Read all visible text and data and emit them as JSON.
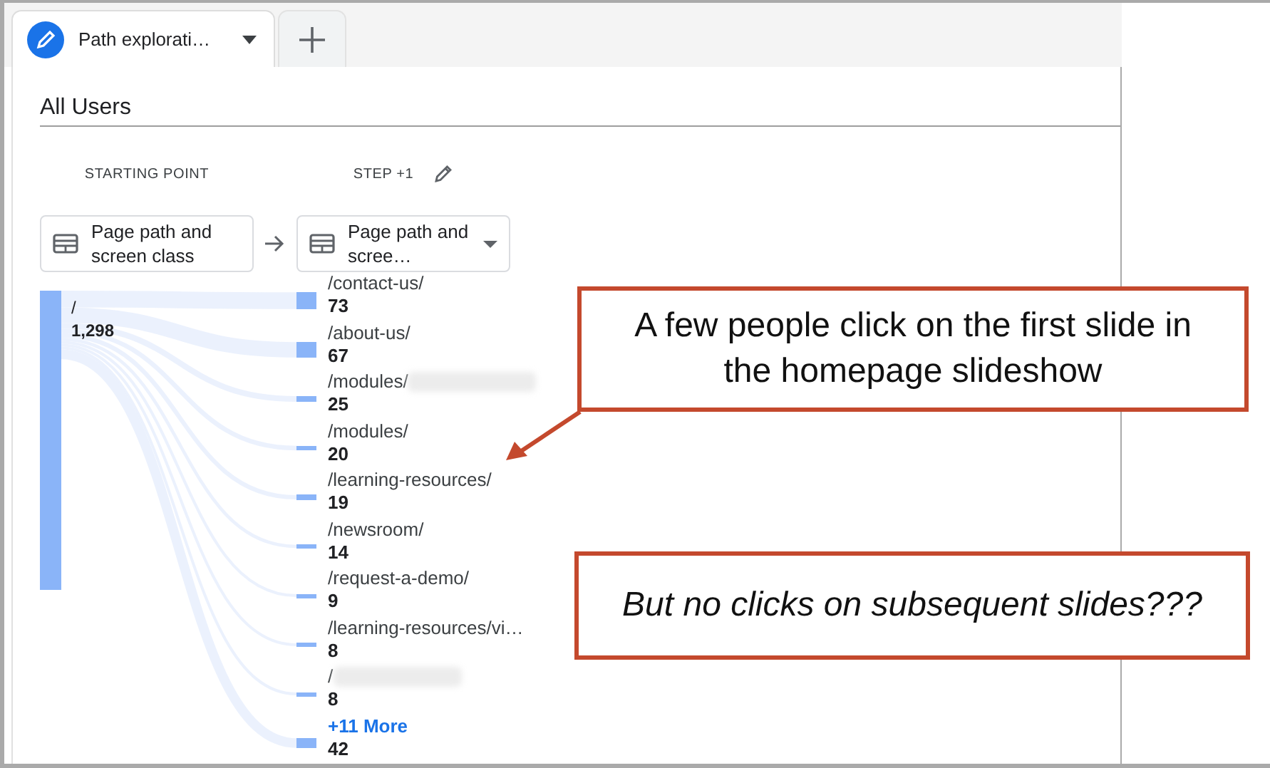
{
  "tab": {
    "title": "Path explorati…",
    "selected": true
  },
  "segment": "All Users",
  "columns": [
    {
      "heading": "STARTING POINT",
      "dimension": "Page path and screen class",
      "editable": false,
      "dropdown": false
    },
    {
      "heading": "STEP +1",
      "dimension": "Page path and scree…",
      "editable": true,
      "dropdown": true
    }
  ],
  "start_node": {
    "label": "/",
    "count": "1,298"
  },
  "step_nodes": [
    {
      "kind": "path",
      "label": "/contact-us/",
      "count": "73",
      "redacted": false
    },
    {
      "kind": "path",
      "label": "/about-us/",
      "count": "67",
      "redacted": false
    },
    {
      "kind": "path",
      "label": "/modules/",
      "count": "25",
      "redacted": true
    },
    {
      "kind": "path",
      "label": "/modules/",
      "count": "20",
      "redacted": false
    },
    {
      "kind": "path",
      "label": "/learning-resources/",
      "count": "19",
      "redacted": false
    },
    {
      "kind": "path",
      "label": "/newsroom/",
      "count": "14",
      "redacted": false
    },
    {
      "kind": "path",
      "label": "/request-a-demo/",
      "count": "9",
      "redacted": false
    },
    {
      "kind": "path",
      "label": "/learning-resources/vi…",
      "count": "8",
      "redacted": false
    },
    {
      "kind": "path",
      "label": "/",
      "count": "8",
      "redacted": true
    },
    {
      "kind": "more",
      "label": "+11 More",
      "count": "42",
      "redacted": false
    }
  ],
  "callouts": [
    {
      "kind": "pointer",
      "text": "A few people click on the first slide in the homepage slideshow",
      "italic": false
    },
    {
      "kind": "plain",
      "text": "But no clicks on subsequent slides???",
      "italic": true
    }
  ]
}
